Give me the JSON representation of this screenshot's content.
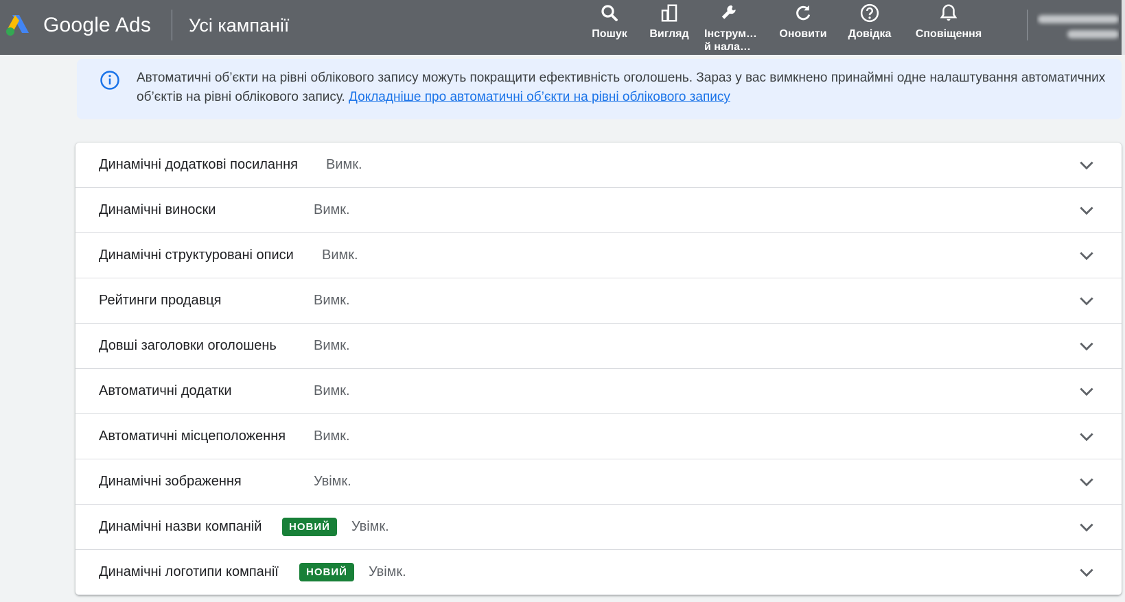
{
  "header": {
    "brand": "Google Ads",
    "title": "Усі кампанії",
    "tools": [
      {
        "label": "Пошук",
        "icon": "search-icon"
      },
      {
        "label": "Вигляд",
        "icon": "view-icon"
      },
      {
        "label": "Інструм…\nй нала…",
        "icon": "wrench-icon"
      },
      {
        "label": "Оновити",
        "icon": "refresh-icon"
      },
      {
        "label": "Довідка",
        "icon": "help-icon"
      },
      {
        "label": "Сповіщення",
        "icon": "bell-icon"
      }
    ]
  },
  "banner": {
    "text": "Автоматичні об’єкти на рівні облікового запису можуть покращити ефективність оголошень. Зараз у вас вимкнено принаймні одне налаштування автоматичних об’єктів на рівні облікового запису. ",
    "link": "Докладніше про автоматичні об’єкти на рівні облікового запису"
  },
  "rows": [
    {
      "name": "Динамічні додаткові посилання",
      "status": "Вимк."
    },
    {
      "name": "Динамічні виноски",
      "status": "Вимк."
    },
    {
      "name": "Динамічні структуровані описи",
      "status": "Вимк."
    },
    {
      "name": "Рейтинги продавця",
      "status": "Вимк."
    },
    {
      "name": "Довші заголовки оголошень",
      "status": "Вимк."
    },
    {
      "name": "Автоматичні додатки",
      "status": "Вимк."
    },
    {
      "name": "Автоматичні місцеположення",
      "status": "Вимк."
    },
    {
      "name": "Динамічні зображення",
      "status": "Увімк."
    },
    {
      "name": "Динамічні назви компаній",
      "badge": "НОВИЙ",
      "status": "Увімк."
    },
    {
      "name": "Динамічні логотипи компанії",
      "badge": "НОВИЙ",
      "status": "Увімк."
    }
  ],
  "colors": {
    "header_bg": "#5f6368",
    "banner_bg": "#e8f0fe",
    "link": "#1a73e8",
    "badge_bg": "#188038"
  }
}
